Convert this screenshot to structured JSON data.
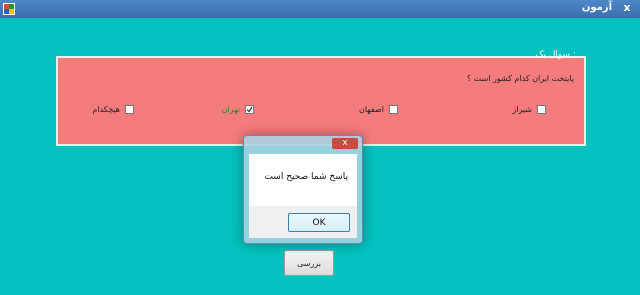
{
  "window": {
    "title": "آزمون",
    "close_glyph": "x"
  },
  "quiz": {
    "group_title": "سوال یک :",
    "question": "پایتخت ایران کدام کشور است ؟",
    "options": [
      {
        "label": "شیراز",
        "checked": false
      },
      {
        "label": "اصفهان",
        "checked": false
      },
      {
        "label": "تهران",
        "checked": true
      },
      {
        "label": "هیچکدام",
        "checked": false
      }
    ],
    "check_button": "بررسی"
  },
  "dialog": {
    "message": "پاسخ شما صحیح است",
    "ok_label": "OK",
    "close_glyph": "x"
  },
  "icons": {
    "app_icon": "app-icon",
    "check_mark": "check-mark-icon"
  },
  "colors": {
    "background": "#03c2bf",
    "group_background": "#f57c7c",
    "correct_answer": "#2b8a2b"
  }
}
